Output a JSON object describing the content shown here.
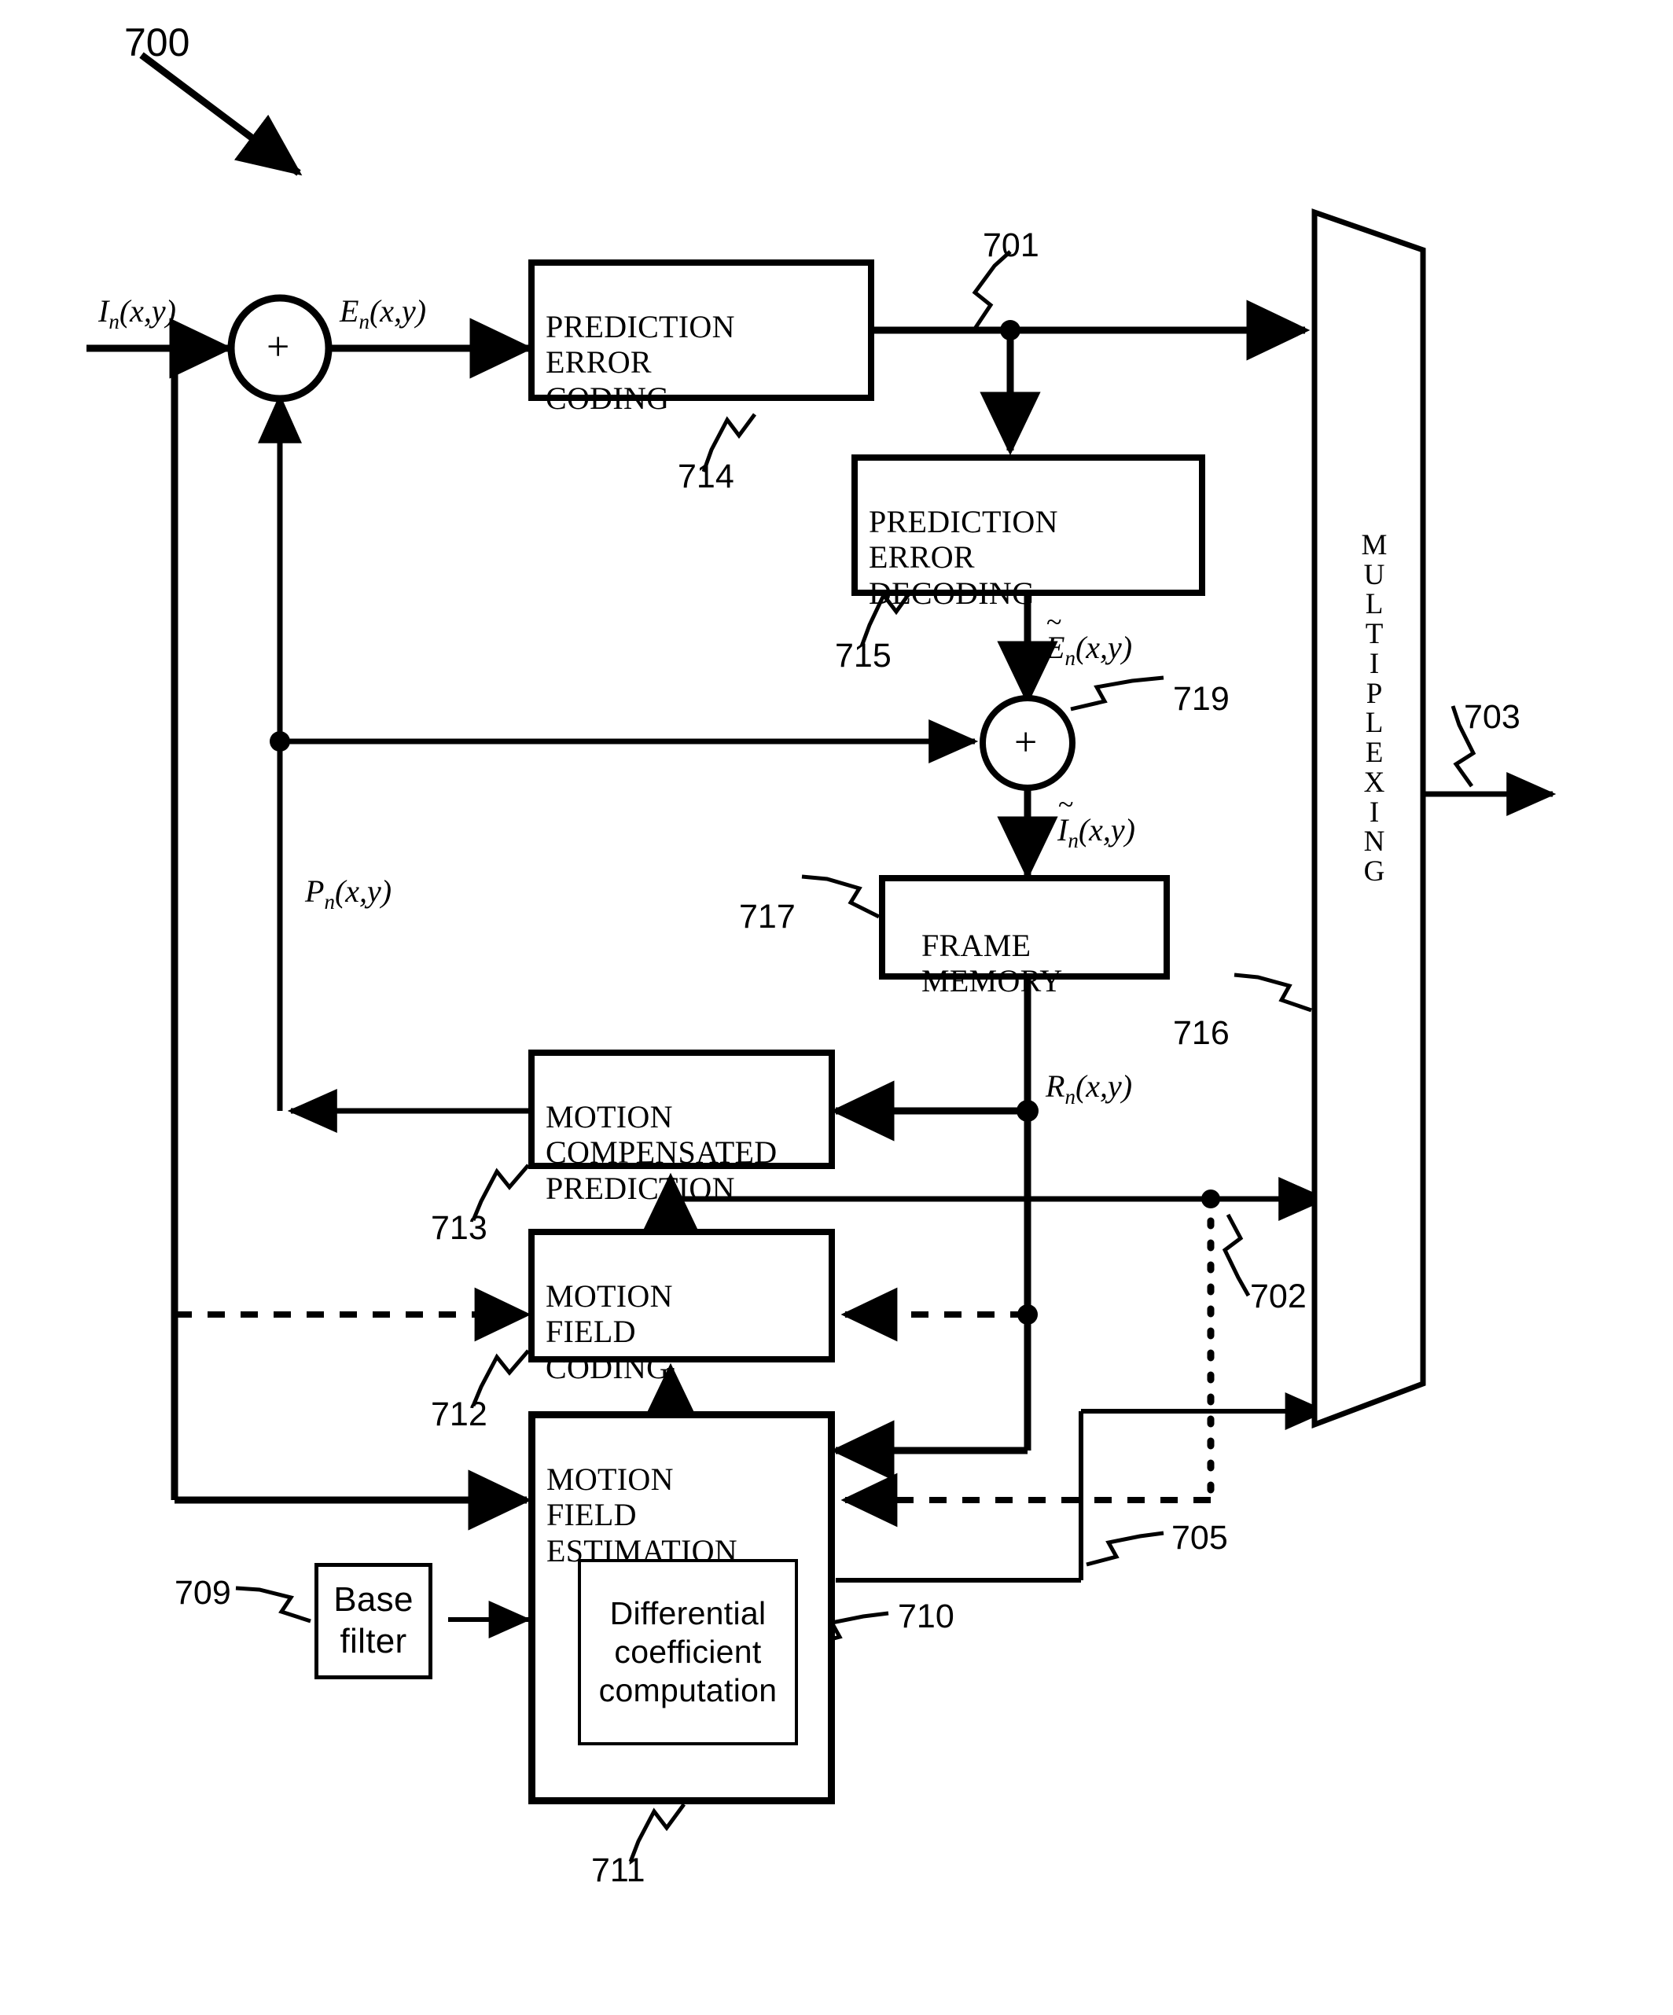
{
  "figure": {
    "number": "700",
    "caption_ref": "700"
  },
  "blocks": {
    "prediction_error_coding": {
      "text": "PREDICTION\nERROR\nCODING",
      "ref": "714"
    },
    "prediction_error_decoding": {
      "text": "PREDICTION\nERROR\nDECODING",
      "ref": "715"
    },
    "frame_memory": {
      "text": "FRAME\n  MEMORY",
      "ref": "717"
    },
    "motion_compensated_prediction": {
      "text": "MOTION\nCOMPENSATED\nPREDICTION",
      "ref": "713"
    },
    "motion_field_coding": {
      "text": "MOTION\nFIELD\nCODING",
      "ref": "712"
    },
    "motion_field_estimation": {
      "text": "MOTION\nFIELD\nESTIMATION",
      "ref": "711"
    },
    "differential_coefficient_computation": {
      "text": "Differential\ncoefficient\ncomputation",
      "ref": "710"
    },
    "base_filter": {
      "text": "Base\nfilter",
      "ref": "709"
    },
    "multiplexing": {
      "text": "M\nU\nL\nT\nI\nP\nL\nE\nX\nI\nN\nG",
      "ref": "716"
    }
  },
  "adders": {
    "input_adder": {
      "symbol": "+"
    },
    "reconstruction_adder": {
      "symbol": "+",
      "ref": "719"
    }
  },
  "signals": {
    "input_frame": {
      "base": "I",
      "sub": "n",
      "args": "(x,y)",
      "tilde": false
    },
    "prediction_error": {
      "base": "E",
      "sub": "n",
      "args": "(x,y)",
      "tilde": false
    },
    "decoded_prediction_error": {
      "base": "E",
      "sub": "n",
      "args": "(x,y)",
      "tilde": true
    },
    "reconstructed_frame": {
      "base": "I",
      "sub": "n",
      "args": "(x,y)",
      "tilde": true
    },
    "reference_frame": {
      "base": "R",
      "sub": "n",
      "args": "(x,y)",
      "tilde": false
    },
    "prediction_frame": {
      "base": "P",
      "sub": "n",
      "args": "(x,y)",
      "tilde": false
    }
  },
  "reference_numerals": {
    "figure": "700",
    "coded_error_path": "701",
    "motion_info_path": "702",
    "output_bitstream": "703",
    "feedback_path": "705",
    "base_filter": "709",
    "differential_coefficient_computation": "710",
    "motion_field_estimation": "711",
    "motion_field_coding": "712",
    "motion_compensated_prediction": "713",
    "prediction_error_coding": "714",
    "prediction_error_decoding": "715",
    "multiplexing": "716",
    "frame_memory": "717",
    "reconstruction_adder": "719"
  },
  "colors": {
    "line": "#000000",
    "background": "#ffffff"
  }
}
